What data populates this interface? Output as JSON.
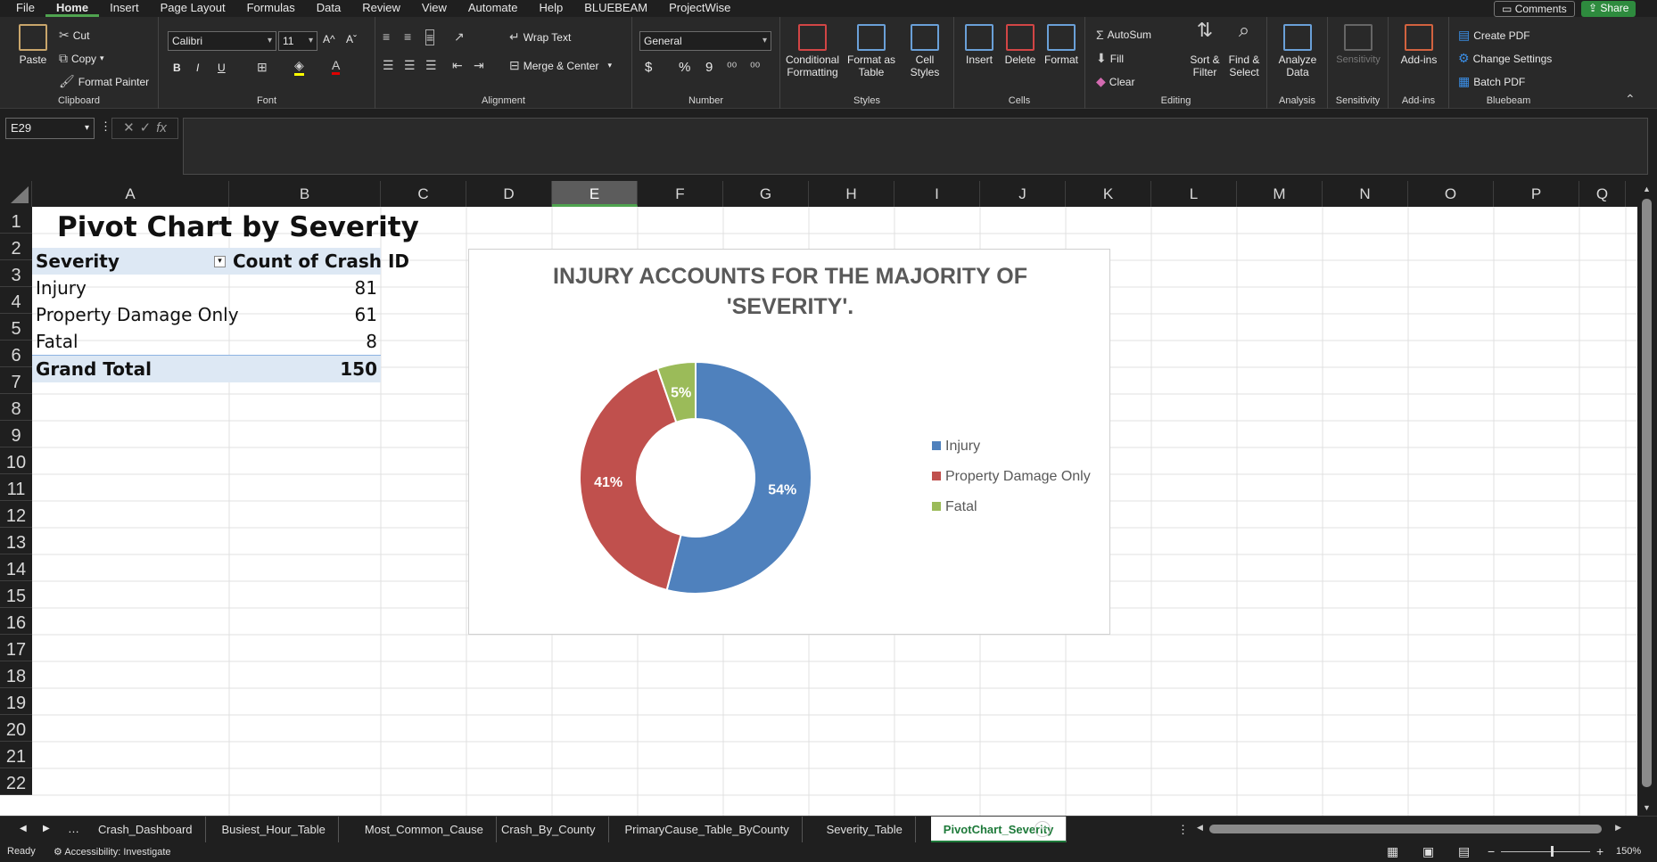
{
  "menu": {
    "tabs": [
      "File",
      "Home",
      "Insert",
      "Page Layout",
      "Formulas",
      "Data",
      "Review",
      "View",
      "Automate",
      "Help",
      "BLUEBEAM",
      "ProjectWise"
    ],
    "active": "Home",
    "comments": "Comments",
    "share": "Share"
  },
  "ribbon": {
    "clipboard": {
      "label": "Clipboard",
      "paste": "Paste",
      "cut": "Cut",
      "copy": "Copy",
      "format_painter": "Format Painter"
    },
    "font": {
      "label": "Font",
      "name": "Calibri",
      "size": "11",
      "bold": "B",
      "italic": "I",
      "underline": "U",
      "grow": "A^",
      "shrink": "Aˇ"
    },
    "alignment": {
      "label": "Alignment",
      "wrap": "Wrap Text",
      "merge": "Merge & Center"
    },
    "number": {
      "label": "Number",
      "format": "General",
      "currency": "$",
      "percent": "%",
      "comma": "9"
    },
    "styles": {
      "label": "Styles",
      "conditional": "Conditional Formatting",
      "format_table": "Format as Table",
      "cell_styles": "Cell Styles"
    },
    "cells": {
      "label": "Cells",
      "insert": "Insert",
      "delete": "Delete",
      "format": "Format"
    },
    "editing": {
      "label": "Editing",
      "autosum": "AutoSum",
      "fill": "Fill",
      "clear": "Clear",
      "sort": "Sort & Filter",
      "find": "Find & Select"
    },
    "analysis": {
      "label": "Analysis",
      "analyze": "Analyze Data"
    },
    "sensitivity": {
      "label": "Sensitivity",
      "btn": "Sensitivity"
    },
    "addins": {
      "label": "Add-ins",
      "btn": "Add-ins"
    },
    "bluebeam": {
      "label": "Bluebeam",
      "create": "Create PDF",
      "settings": "Change Settings",
      "batch": "Batch PDF"
    }
  },
  "formula_bar": {
    "name_box": "E29",
    "fx": "fx",
    "value": ""
  },
  "columns": [
    "A",
    "B",
    "C",
    "D",
    "E",
    "F",
    "G",
    "H",
    "I",
    "J",
    "K",
    "L",
    "M",
    "N",
    "O",
    "P",
    "Q"
  ],
  "selected_column": "E",
  "rows": [
    "1",
    "2",
    "3",
    "4",
    "5",
    "6",
    "7",
    "8",
    "9",
    "10",
    "11",
    "12",
    "13",
    "14",
    "15",
    "16",
    "17",
    "18",
    "19",
    "20",
    "21",
    "22"
  ],
  "pivot": {
    "title": "Pivot Chart by Severity",
    "header_left": "Severity",
    "header_right": "Count of Crash ID",
    "rows": [
      {
        "label": "Injury",
        "value": "81"
      },
      {
        "label": "Property Damage Only",
        "value": "61"
      },
      {
        "label": "Fatal",
        "value": "8"
      }
    ],
    "total_label": "Grand Total",
    "total_value": "150"
  },
  "chart_data": {
    "type": "pie",
    "variant": "doughnut",
    "title": "INJURY ACCOUNTS FOR THE MAJORITY OF 'SEVERITY'.",
    "categories": [
      "Injury",
      "Property Damage Only",
      "Fatal"
    ],
    "values": [
      81,
      61,
      8
    ],
    "data_labels": [
      "54%",
      "41%",
      "5%"
    ],
    "colors": [
      "#4f81bd",
      "#c0504d",
      "#9bbb59"
    ],
    "legend": "right"
  },
  "sheet_tabs": [
    "Crash_Dashboard",
    "Busiest_Hour_Table",
    "Most_Common_Cause",
    "Crash_By_County",
    "PrimaryCause_Table_ByCounty",
    "Severity_Table",
    "PivotChart_Severity"
  ],
  "active_tab": "PivotChart_Severity",
  "status": {
    "ready": "Ready",
    "accessibility": "Accessibility: Investigate",
    "zoom": "150%"
  }
}
